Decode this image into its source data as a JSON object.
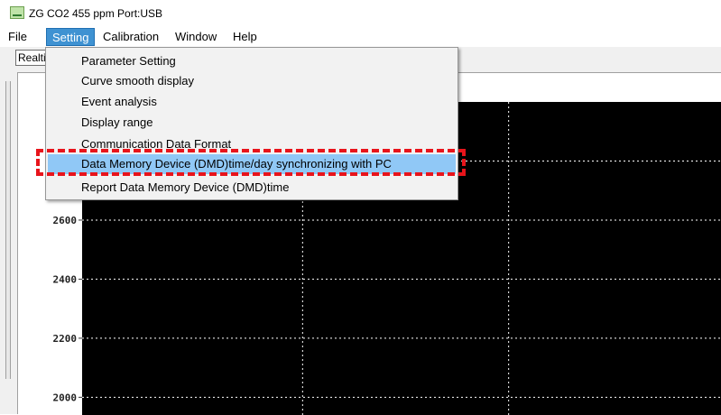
{
  "window": {
    "title": "ZG CO2 455 ppm  Port:USB",
    "icon": "app-graph-icon"
  },
  "menubar": {
    "items": [
      {
        "label": "File"
      },
      {
        "label": "Setting"
      },
      {
        "label": "Calibration"
      },
      {
        "label": "Window"
      },
      {
        "label": "Help"
      }
    ],
    "active": "Setting"
  },
  "toolbar": {
    "button_label": "Realtime"
  },
  "setting_menu": {
    "items": [
      {
        "label": "Parameter Setting"
      },
      {
        "label": "Curve smooth display"
      },
      {
        "label": "Event analysis"
      },
      {
        "label": "Display range"
      },
      {
        "label": "Communication Data Format"
      },
      {
        "label": "Data Memory Device (DMD)time/day synchronizing with PC"
      },
      {
        "label": "Report Data Memory Device (DMD)time"
      }
    ],
    "highlighted_index": 5,
    "annotation_color": "#e8141b"
  },
  "chart_data": {
    "type": "line",
    "title": "",
    "xlabel": "",
    "ylabel": "",
    "y_ticks": [
      2000,
      2200,
      2400,
      2600
    ],
    "ylim": [
      1940,
      3000
    ],
    "series": [],
    "background": "#000000",
    "grid": true,
    "grid_color": "#ffffff",
    "tick_label_color": "#ffffff"
  }
}
